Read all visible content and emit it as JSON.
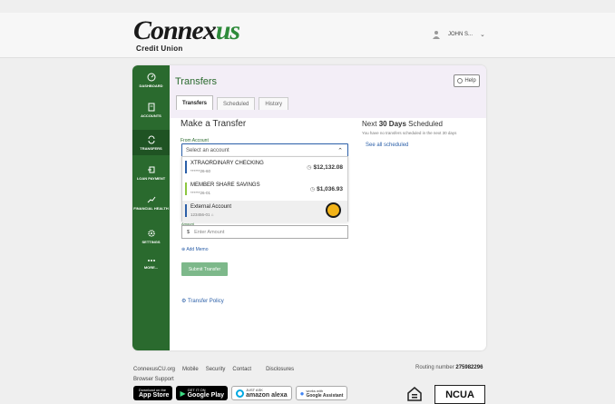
{
  "brand": {
    "name_part1": "Conne",
    "name_x": "x",
    "name_part2": "us",
    "subtitle": "Credit Union"
  },
  "user": {
    "name": "JOHN S...",
    "chevron": "⌄"
  },
  "nav": {
    "items": [
      {
        "label": "DASHBOARD",
        "icon": "speedometer-icon"
      },
      {
        "label": "ACCOUNTS",
        "icon": "document-icon"
      },
      {
        "label": "TRANSFERS",
        "icon": "transfer-arrows-icon"
      },
      {
        "label": "LOAN PAYMENT",
        "icon": "loan-payment-icon"
      },
      {
        "label": "FINANCIAL HEALTH",
        "icon": "trend-icon"
      },
      {
        "label": "SETTINGS",
        "icon": "gear-icon"
      },
      {
        "label": "MORE...",
        "icon": "more-dots-icon"
      }
    ],
    "active": "TRANSFERS"
  },
  "page": {
    "title": "Transfers",
    "help_label": "Help",
    "tabs": [
      {
        "label": "Transfers"
      },
      {
        "label": "Scheduled"
      },
      {
        "label": "History"
      }
    ],
    "active_tab": "Transfers"
  },
  "form": {
    "heading": "Make a Transfer",
    "from_label": "From Account",
    "select_placeholder": "Select an account",
    "accounts": [
      {
        "name": "XTRAORDINARY CHECKING",
        "number": "******26-60",
        "balance": "$12,132.08",
        "color": "#2b5fa8"
      },
      {
        "name": "MEMBER SHARE SAVINGS",
        "number": "******26-01",
        "balance": "$1,036.93",
        "color": "#8cc63f"
      },
      {
        "name": "External Account",
        "number": "123456-01",
        "balance": "",
        "color": "#2b5fa8"
      }
    ],
    "amount_label": "Amount",
    "amount_currency": "$",
    "amount_placeholder": "Enter Amount",
    "add_memo": "Add Memo",
    "submit_label": "Submit Transfer",
    "policy_link": "Transfer Policy"
  },
  "scheduled": {
    "prefix": "Next",
    "days": "30 Days",
    "suffix": "Scheduled",
    "note": "You have no transfers scheduled in the next 30 days",
    "link": "See all scheduled"
  },
  "footer": {
    "links": [
      "ConnexusCU.org",
      "Mobile",
      "Security",
      "Contact",
      "Disclosures"
    ],
    "support": "Browser Support",
    "routing_label": "Routing number",
    "routing_number": "275982296",
    "badges": [
      {
        "small": "Download on the",
        "big": "App Store"
      },
      {
        "small": "GET IT ON",
        "big": "Google Play"
      },
      {
        "small": "JUST ASK",
        "big": "amazon alexa"
      },
      {
        "small": "works with",
        "big": "Google Assistant"
      }
    ],
    "ncua": "NCUA"
  },
  "colors": {
    "brand_green": "#2a6a2e",
    "link_blue": "#2b5fa8",
    "accent_gold": "#f2b318"
  }
}
